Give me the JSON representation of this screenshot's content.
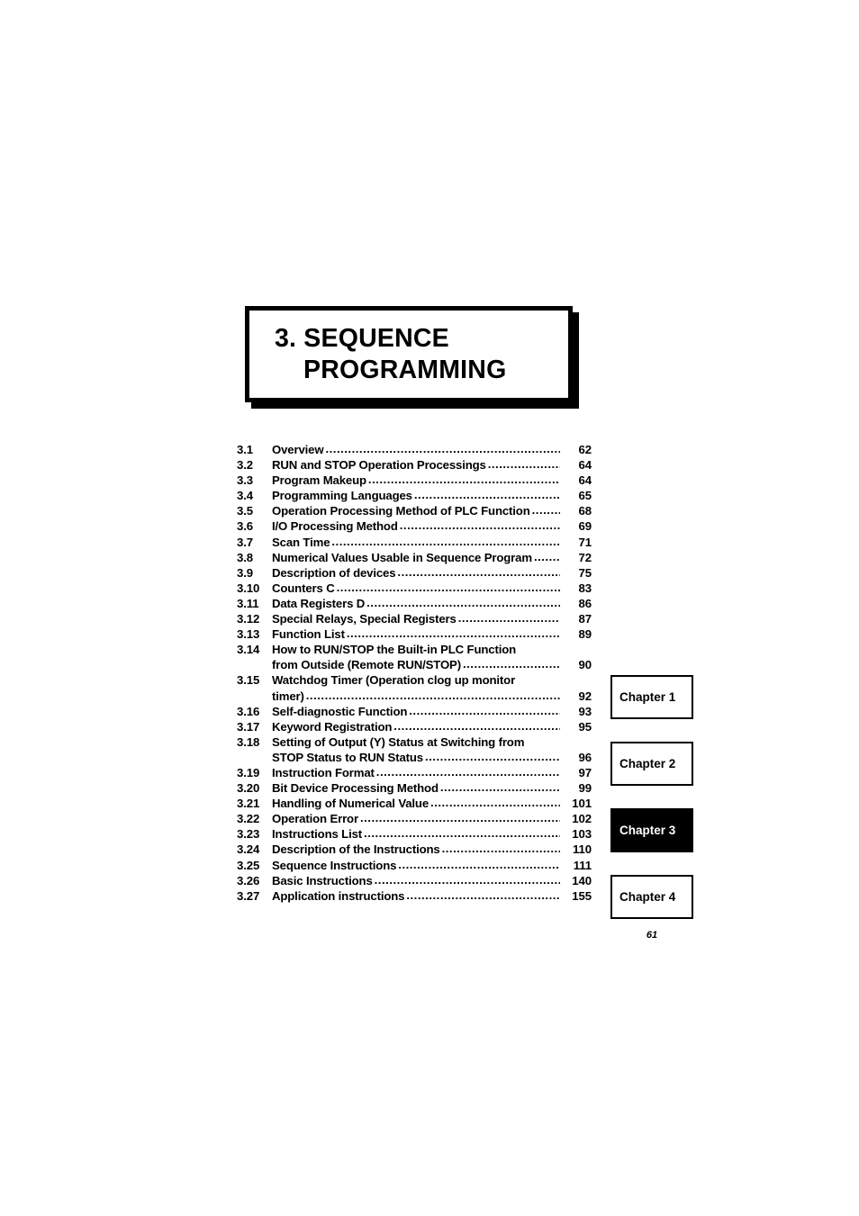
{
  "chapter": {
    "title_line1": "3. SEQUENCE",
    "title_line2": "PROGRAMMING"
  },
  "toc": {
    "entries": [
      {
        "number": "3.1",
        "label": "Overview",
        "label2": "",
        "page": "62"
      },
      {
        "number": "3.2",
        "label": "RUN and STOP Operation Processings",
        "label2": "",
        "page": "64"
      },
      {
        "number": "3.3",
        "label": "Program Makeup",
        "label2": "",
        "page": "64"
      },
      {
        "number": "3.4",
        "label": "Programming Languages",
        "label2": "",
        "page": "65"
      },
      {
        "number": "3.5",
        "label": "Operation Processing Method of PLC Function",
        "label2": "",
        "page": "68"
      },
      {
        "number": "3.6",
        "label": "I/O Processing Method",
        "label2": "",
        "page": "69"
      },
      {
        "number": "3.7",
        "label": "Scan Time",
        "label2": "",
        "page": "71"
      },
      {
        "number": "3.8",
        "label": "Numerical Values Usable in Sequence Program",
        "label2": "",
        "page": "72"
      },
      {
        "number": "3.9",
        "label": "Description of devices",
        "label2": "",
        "page": "75"
      },
      {
        "number": "3.10",
        "label": "Counters C",
        "label2": "",
        "page": "83"
      },
      {
        "number": "3.11",
        "label": "Data Registers D",
        "label2": "",
        "page": "86"
      },
      {
        "number": "3.12",
        "label": "Special Relays, Special Registers",
        "label2": "",
        "page": "87"
      },
      {
        "number": "3.13",
        "label": "Function List",
        "label2": "",
        "page": "89"
      },
      {
        "number": "3.14",
        "label": "How to RUN/STOP the Built-in PLC Function",
        "label2": "from Outside (Remote RUN/STOP)",
        "page": "90"
      },
      {
        "number": "3.15",
        "label": "Watchdog Timer (Operation clog up monitor",
        "label2": "timer)",
        "page": "92"
      },
      {
        "number": "3.16",
        "label": "Self-diagnostic Function",
        "label2": "",
        "page": "93"
      },
      {
        "number": "3.17",
        "label": "Keyword Registration",
        "label2": "",
        "page": "95"
      },
      {
        "number": "3.18",
        "label": "Setting of Output (Y) Status at Switching from",
        "label2": "STOP Status to RUN Status",
        "page": "96"
      },
      {
        "number": "3.19",
        "label": "Instruction Format",
        "label2": "",
        "page": "97"
      },
      {
        "number": "3.20",
        "label": "Bit Device Processing Method",
        "label2": "",
        "page": "99"
      },
      {
        "number": "3.21",
        "label": "Handling of Numerical Value",
        "label2": "",
        "page": "101"
      },
      {
        "number": "3.22",
        "label": "Operation Error",
        "label2": "",
        "page": "102"
      },
      {
        "number": "3.23",
        "label": "Instructions List",
        "label2": "",
        "page": "103"
      },
      {
        "number": "3.24",
        "label": "Description of the Instructions",
        "label2": "",
        "page": "110"
      },
      {
        "number": "3.25",
        "label": "Sequence Instructions",
        "label2": "",
        "page": "111"
      },
      {
        "number": "3.26",
        "label": "Basic Instructions",
        "label2": "",
        "page": "140"
      },
      {
        "number": "3.27",
        "label": "Application instructions",
        "label2": "",
        "page": "155"
      }
    ]
  },
  "chapter_tabs": [
    {
      "label": "Chapter 1",
      "current": false
    },
    {
      "label": "Chapter 2",
      "current": false
    },
    {
      "label": "Chapter 3",
      "current": true
    },
    {
      "label": "Chapter 4",
      "current": false
    }
  ],
  "footer": {
    "page_number": "61"
  }
}
